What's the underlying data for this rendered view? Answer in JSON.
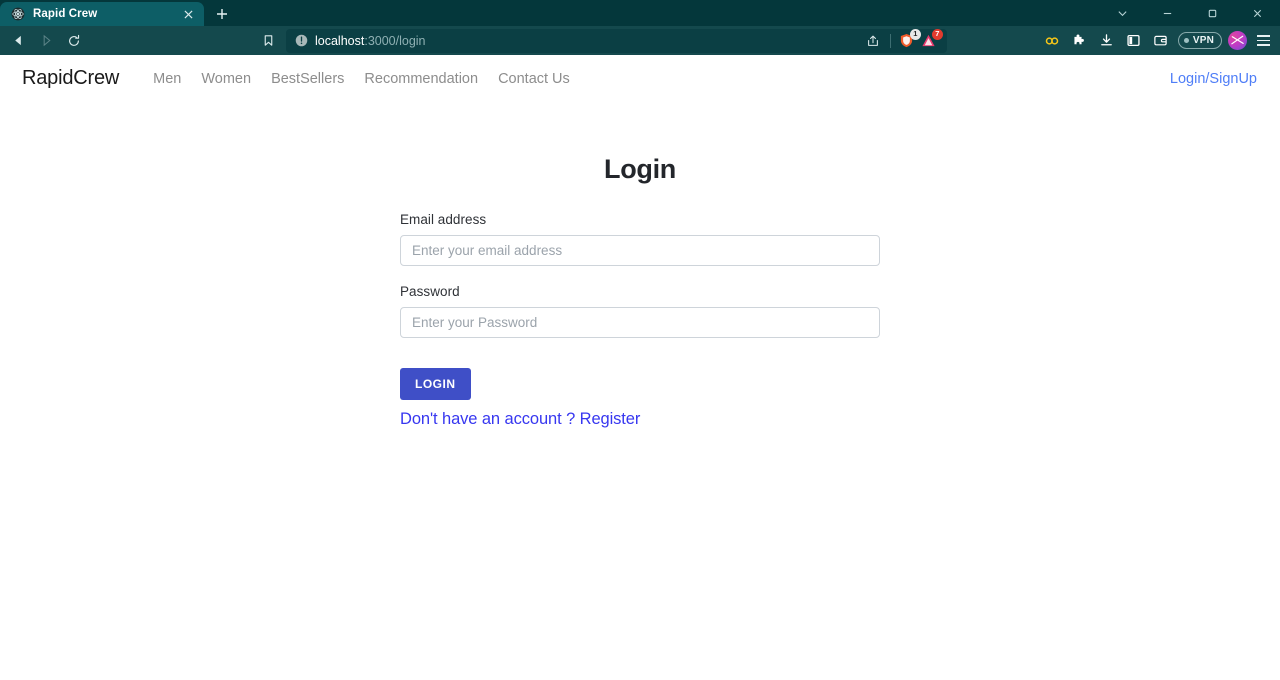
{
  "browser": {
    "tab": {
      "title": "Rapid Crew",
      "favicon": "react-atom-icon",
      "close_icon": "close-icon"
    },
    "new_tab_label": "+",
    "window_controls": [
      {
        "name": "tab-search-button",
        "icon": "chevron-down-icon"
      },
      {
        "name": "minimize-button",
        "icon": "minimize-icon"
      },
      {
        "name": "maximize-button",
        "icon": "maximize-icon"
      },
      {
        "name": "close-window-button",
        "icon": "close-icon"
      }
    ],
    "nav": {
      "back": "back-arrow-icon",
      "forward": "forward-arrow-icon",
      "reload": "reload-icon",
      "bookmark": "bookmark-icon"
    },
    "omnibox": {
      "site_info_icon": "not-secure-info-icon",
      "url_host": "localhost",
      "url_path": ":3000/login",
      "share_icon": "share-icon",
      "shield_icon": "brave-shield-icon",
      "shield_badge": "1",
      "adblock_icon": "adblock-triangle-icon",
      "adblock_badge": "7"
    },
    "extensions": [
      {
        "name": "password-manager-icon",
        "icon": "infinity-icon",
        "color": "#f5c518"
      },
      {
        "name": "extensions-puzzle-icon",
        "icon": "puzzle-icon",
        "color": "#ffffff"
      },
      {
        "name": "downloads-icon",
        "icon": "download-icon",
        "color": "#ffffff"
      },
      {
        "name": "split-view-icon",
        "icon": "panel-icon",
        "color": "#ffffff"
      },
      {
        "name": "wallet-icon",
        "icon": "wallet-icon",
        "color": "#ffffff"
      }
    ],
    "vpn": {
      "label": "VPN",
      "status_dot": "#9fc0c2"
    },
    "profile": "profile-avatar",
    "menu": "hamburger-menu-icon",
    "colors": {
      "tabstrip_bg": "#04373b",
      "active_tab": "#0d5e66",
      "toolbar_bg": "#14494d",
      "omnibox_bg": "#0b3f44"
    }
  },
  "site": {
    "brand": "RapidCrew",
    "nav_links": [
      {
        "label": "Men"
      },
      {
        "label": "Women"
      },
      {
        "label": "BestSellers"
      },
      {
        "label": "Recommendation"
      },
      {
        "label": "Contact Us"
      }
    ],
    "auth_link": "Login/SignUp",
    "auth_link_color": "#4f7ef7"
  },
  "login": {
    "title": "Login",
    "email": {
      "label": "Email address",
      "placeholder": "Enter your email address",
      "value": ""
    },
    "password": {
      "label": "Password",
      "placeholder": "Enter your Password",
      "value": ""
    },
    "submit_label": "LOGIN",
    "submit_color": "#3f4fc7",
    "register_text": "Don't have an account ? Register",
    "register_color": "#3737f0"
  }
}
